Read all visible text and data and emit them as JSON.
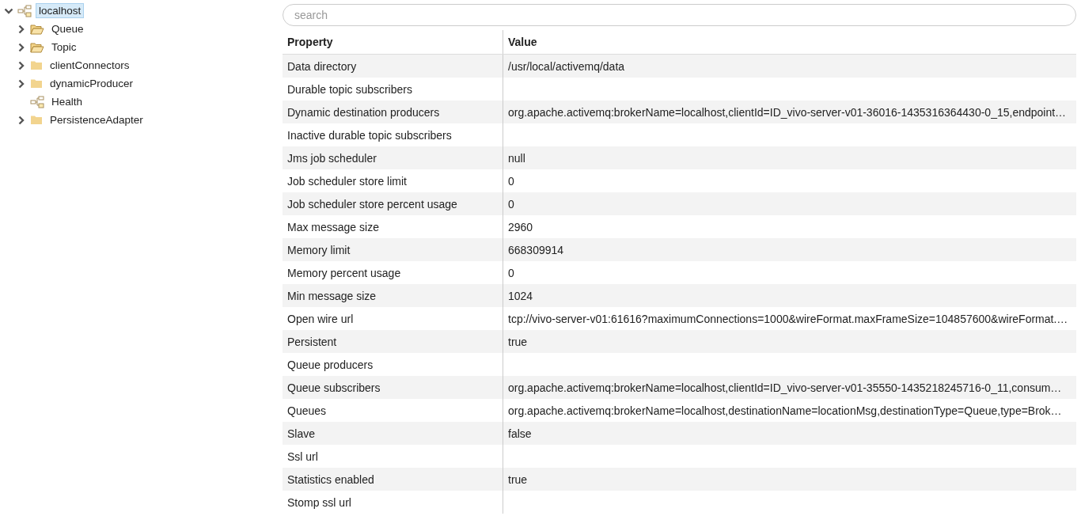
{
  "tree": [
    {
      "label": "localhost",
      "kind": "node",
      "selected": true,
      "expanded": true,
      "children": [
        {
          "label": "Queue",
          "kind": "folder-open",
          "selected": false,
          "expanded": false
        },
        {
          "label": "Topic",
          "kind": "folder-open",
          "selected": false,
          "expanded": false
        },
        {
          "label": "clientConnectors",
          "kind": "folder",
          "selected": false,
          "expanded": false
        },
        {
          "label": "dynamicProducer",
          "kind": "folder",
          "selected": false,
          "expanded": false
        },
        {
          "label": "Health",
          "kind": "node",
          "selected": false
        },
        {
          "label": "PersistenceAdapter",
          "kind": "folder",
          "selected": false,
          "expanded": false
        }
      ]
    }
  ],
  "search": {
    "placeholder": "search"
  },
  "table": {
    "columns": [
      "Property",
      "Value"
    ],
    "rows": [
      {
        "property": "Data directory",
        "value": "/usr/local/activemq/data"
      },
      {
        "property": "Durable topic subscribers",
        "value": ""
      },
      {
        "property": "Dynamic destination producers",
        "value": "org.apache.activemq:brokerName=localhost,clientId=ID_vivo-server-v01-36016-1435316364430-0_15,endpoint…"
      },
      {
        "property": "Inactive durable topic subscribers",
        "value": ""
      },
      {
        "property": "Jms job scheduler",
        "value": "null"
      },
      {
        "property": "Job scheduler store limit",
        "value": "0"
      },
      {
        "property": "Job scheduler store percent usage",
        "value": "0"
      },
      {
        "property": "Max message size",
        "value": "2960"
      },
      {
        "property": "Memory limit",
        "value": "668309914"
      },
      {
        "property": "Memory percent usage",
        "value": "0"
      },
      {
        "property": "Min message size",
        "value": "1024"
      },
      {
        "property": "Open wire url",
        "value": "tcp://vivo-server-v01:61616?maximumConnections=1000&wireFormat.maxFrameSize=104857600&wireFormat.…"
      },
      {
        "property": "Persistent",
        "value": "true"
      },
      {
        "property": "Queue producers",
        "value": ""
      },
      {
        "property": "Queue subscribers",
        "value": "org.apache.activemq:brokerName=localhost,clientId=ID_vivo-server-v01-35550-1435218245716-0_11,consum…"
      },
      {
        "property": "Queues",
        "value": "org.apache.activemq:brokerName=localhost,destinationName=locationMsg,destinationType=Queue,type=Brok…"
      },
      {
        "property": "Slave",
        "value": "false"
      },
      {
        "property": "Ssl url",
        "value": ""
      },
      {
        "property": "Statistics enabled",
        "value": "true"
      },
      {
        "property": "Stomp ssl url",
        "value": ""
      }
    ]
  }
}
